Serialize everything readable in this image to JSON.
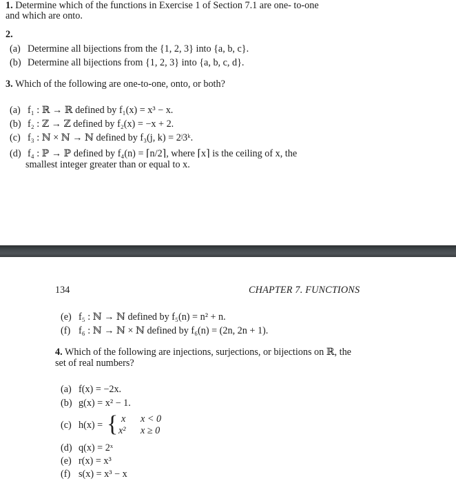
{
  "page_top": {
    "q1": {
      "number": "1.",
      "line1": "Determine which of the functions in Exercise 1 of Section 7.1 are one- to-one",
      "line2": "and which are onto."
    },
    "q2": {
      "number": "2.",
      "items": [
        {
          "label": "(a)",
          "text": "Determine all bijections from the {1, 2, 3} into {a, b, c}."
        },
        {
          "label": "(b)",
          "text": "Determine all bijections from {1, 2, 3} into {a, b, c, d}."
        }
      ]
    },
    "q3": {
      "number": "3.",
      "prompt": "Which of the following are one-to-one, onto, or both?",
      "items": [
        {
          "label": "(a)",
          "text": "f₁ : ℝ → ℝ defined by f₁(x) = x³ − x."
        },
        {
          "label": "(b)",
          "text": "f₂ : ℤ → ℤ defined by f₂(x) = −x + 2."
        },
        {
          "label": "(c)",
          "text": "f₃ : ℕ × ℕ → ℕ defined by f₃(j, k) = 2ʲ3ᵏ."
        },
        {
          "label": "(d)",
          "text": "f₄ : ℙ → ℙ defined by f₄(n) = ⌈n/2⌉, where ⌈x⌉ is the ceiling of x, the",
          "continuation": "smallest integer greater than or equal to x."
        }
      ]
    }
  },
  "page_bottom": {
    "header": {
      "page_number": "134",
      "chapter": "CHAPTER 7.  FUNCTIONS"
    },
    "q3_cont": {
      "items": [
        {
          "label": "(e)",
          "text": "f₅ : ℕ → ℕ defined by f₅(n) = n² + n."
        },
        {
          "label": "(f)",
          "text": "f₆ : ℕ → ℕ × ℕ defined by f₆(n) = (2n, 2n + 1)."
        }
      ]
    },
    "q4": {
      "number": "4.",
      "line1": "Which of the following are injections, surjections, or bijections on ℝ, the",
      "line2": "set of real numbers?",
      "items": [
        {
          "label": "(a)",
          "text": "f(x) = −2x."
        },
        {
          "label": "(b)",
          "text": "g(x) = x² − 1."
        },
        {
          "label": "(c)",
          "text": "h(x) =",
          "cases": [
            {
              "value": "x",
              "condition": "x < 0"
            },
            {
              "value": "x²",
              "condition": "x ≥ 0"
            }
          ]
        },
        {
          "label": "(d)",
          "text": "q(x) = 2ˣ"
        },
        {
          "label": "(e)",
          "text": "r(x) = x³"
        },
        {
          "label": "(f)",
          "text": "s(x) = x³ − x"
        }
      ]
    }
  },
  "colors": {
    "text": "#1c1c1c",
    "page_background": "#ffffff",
    "page_divider": "#464b4f"
  }
}
